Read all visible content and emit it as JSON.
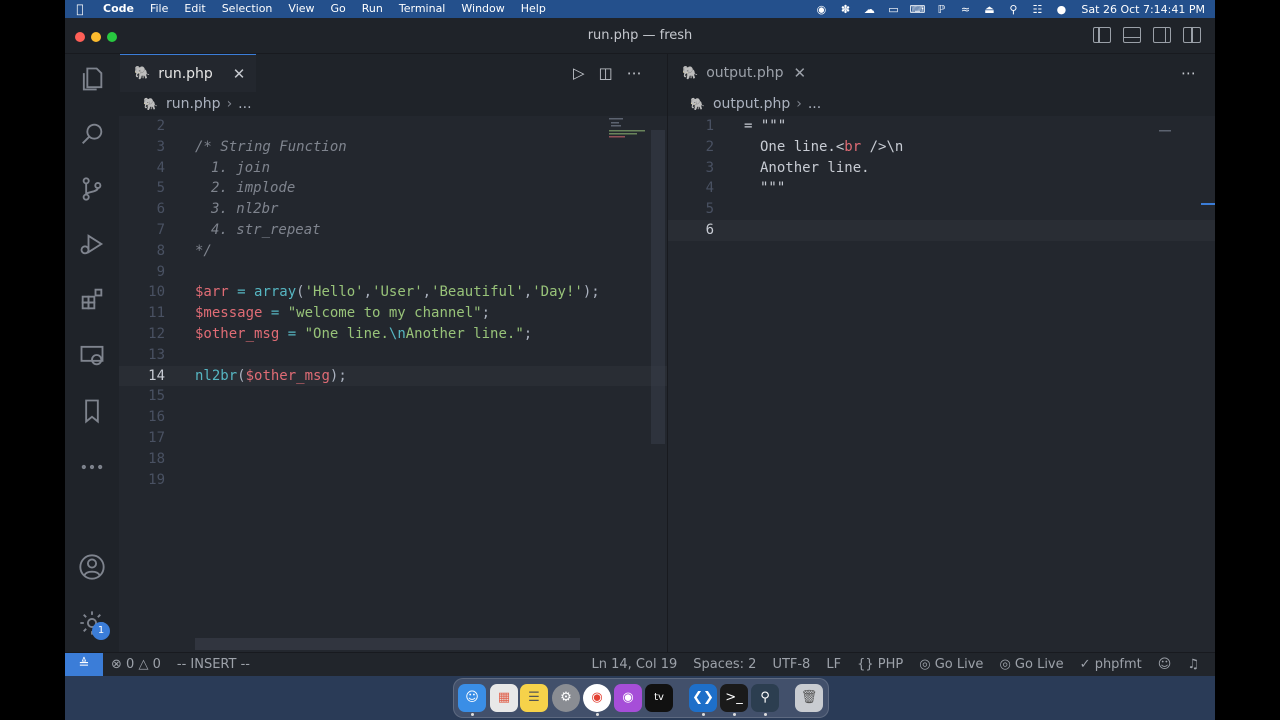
{
  "menubar": {
    "app": "Code",
    "items": [
      "File",
      "Edit",
      "Selection",
      "View",
      "Go",
      "Run",
      "Terminal",
      "Window",
      "Help"
    ],
    "clock": "Sat 26 Oct  7:14:41 PM"
  },
  "window": {
    "title": "run.php — fresh"
  },
  "left_group": {
    "tab_label": "run.php",
    "breadcrumb_file": "run.php",
    "breadcrumb_more": "...",
    "lines": [
      {
        "n": "2",
        "tokens": []
      },
      {
        "n": "3",
        "tokens": [
          {
            "t": "/* String Function",
            "c": "comment"
          }
        ]
      },
      {
        "n": "4",
        "indent": 1,
        "tokens": [
          {
            "t": "1. join",
            "c": "comment"
          }
        ]
      },
      {
        "n": "5",
        "indent": 1,
        "tokens": [
          {
            "t": "2. implode",
            "c": "comment"
          }
        ]
      },
      {
        "n": "6",
        "indent": 1,
        "tokens": [
          {
            "t": "3. nl2br",
            "c": "comment"
          }
        ]
      },
      {
        "n": "7",
        "indent": 1,
        "tokens": [
          {
            "t": "4. str_repeat",
            "c": "comment"
          }
        ]
      },
      {
        "n": "8",
        "tokens": [
          {
            "t": "*/",
            "c": "comment"
          }
        ]
      },
      {
        "n": "9",
        "tokens": []
      },
      {
        "n": "10",
        "tokens": [
          {
            "t": "$arr",
            "c": "var"
          },
          {
            "t": " = ",
            "c": "op"
          },
          {
            "t": "array",
            "c": "func"
          },
          {
            "t": "(",
            "c": "punc"
          },
          {
            "t": "'Hello'",
            "c": "str"
          },
          {
            "t": ",",
            "c": "punc"
          },
          {
            "t": "'User'",
            "c": "str"
          },
          {
            "t": ",",
            "c": "punc"
          },
          {
            "t": "'Beautiful'",
            "c": "str"
          },
          {
            "t": ",",
            "c": "punc"
          },
          {
            "t": "'Day!'",
            "c": "str"
          },
          {
            "t": ");",
            "c": "punc"
          }
        ]
      },
      {
        "n": "11",
        "tokens": [
          {
            "t": "$message",
            "c": "var"
          },
          {
            "t": " = ",
            "c": "op"
          },
          {
            "t": "\"welcome to my channel\"",
            "c": "str"
          },
          {
            "t": ";",
            "c": "punc"
          }
        ]
      },
      {
        "n": "12",
        "tokens": [
          {
            "t": "$other_msg",
            "c": "var"
          },
          {
            "t": " = ",
            "c": "op"
          },
          {
            "t": "\"One line.",
            "c": "str"
          },
          {
            "t": "\\n",
            "c": "esc"
          },
          {
            "t": "Another line.\"",
            "c": "str"
          },
          {
            "t": ";",
            "c": "punc"
          }
        ]
      },
      {
        "n": "13",
        "tokens": []
      },
      {
        "n": "14",
        "current": true,
        "tokens": [
          {
            "t": "nl2br",
            "c": "func"
          },
          {
            "t": "(",
            "c": "punc"
          },
          {
            "t": "$other_msg",
            "c": "var"
          },
          {
            "t": ");",
            "c": "punc"
          }
        ]
      },
      {
        "n": "15",
        "tokens": []
      },
      {
        "n": "16",
        "tokens": []
      },
      {
        "n": "17",
        "tokens": []
      },
      {
        "n": "18",
        "tokens": []
      },
      {
        "n": "19",
        "tokens": []
      }
    ]
  },
  "right_group": {
    "tab_label": "output.php",
    "breadcrumb_file": "output.php",
    "breadcrumb_more": "...",
    "lines": [
      {
        "n": "1",
        "tokens": [
          {
            "t": "= \"\"\"",
            "c": "plain"
          }
        ]
      },
      {
        "n": "2",
        "indent": 1,
        "tokens": [
          {
            "t": "One line.",
            "c": "plain"
          },
          {
            "t": "<br />",
            "c": "tagmix"
          },
          {
            "t": "\\n",
            "c": "plain"
          }
        ]
      },
      {
        "n": "3",
        "indent": 1,
        "tokens": [
          {
            "t": "Another line.",
            "c": "plain"
          }
        ]
      },
      {
        "n": "4",
        "indent": 1,
        "tokens": [
          {
            "t": "\"\"\"",
            "c": "plain"
          }
        ]
      },
      {
        "n": "5",
        "tokens": []
      },
      {
        "n": "6",
        "current": true,
        "tokens": []
      }
    ]
  },
  "statusbar": {
    "errors": "0",
    "warnings": "0",
    "mode": "-- INSERT --",
    "position": "Ln 14, Col 19",
    "spaces": "Spaces: 2",
    "encoding": "UTF-8",
    "eol": "LF",
    "language": "PHP",
    "golive1": "Go Live",
    "golive2": "Go Live",
    "formatter": "phpfmt"
  },
  "activity": {
    "settings_badge": "1"
  },
  "colors": {
    "accent": "#3b7dd8",
    "editor_bg": "#23272e",
    "menubar_bg": "#24508c"
  }
}
